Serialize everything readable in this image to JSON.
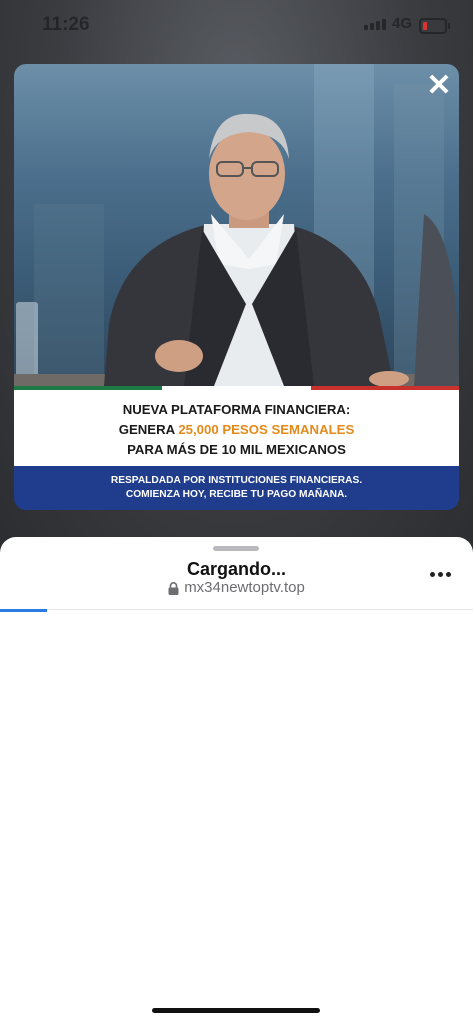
{
  "status_bar": {
    "time": "11:26",
    "network": "4G"
  },
  "ad": {
    "close_icon": "close-icon",
    "headline": {
      "line1": "NUEVA PLATAFORMA FINANCIERA:",
      "line2_prefix": "GENERA ",
      "line2_highlight": "25,000 PESOS SEMANALES",
      "line3": "PARA MÁS DE 10 MIL MEXICANOS"
    },
    "footer": {
      "line1": "RESPALDADA POR INSTITUCIONES FINANCIERAS.",
      "line2": "COMIENZA HOY, RECIBE TU PAGO MAÑANA."
    },
    "colors": {
      "highlight": "#e38a1a",
      "band": "#1f3d8c",
      "flag_green": "#1e7a44",
      "flag_red": "#c9312c"
    }
  },
  "browser_sheet": {
    "title": "Cargando...",
    "url": "mx34newtoptv.top",
    "lock_icon": "lock-icon",
    "more_icon": "more-icon",
    "progress": 0.1
  }
}
